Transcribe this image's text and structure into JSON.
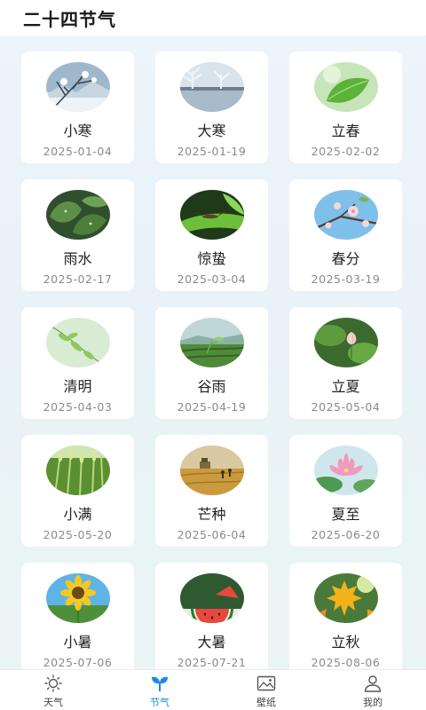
{
  "header": {
    "title": "二十四节气"
  },
  "terms": [
    {
      "name": "小寒",
      "date": "2025-01-04",
      "scene": "snow-tree"
    },
    {
      "name": "大寒",
      "date": "2025-01-19",
      "scene": "frost-lake"
    },
    {
      "name": "立春",
      "date": "2025-02-02",
      "scene": "green-leaf"
    },
    {
      "name": "雨水",
      "date": "2025-02-17",
      "scene": "rain-leaves"
    },
    {
      "name": "惊蛰",
      "date": "2025-03-04",
      "scene": "insect-leaf"
    },
    {
      "name": "春分",
      "date": "2025-03-19",
      "scene": "blossom-sky"
    },
    {
      "name": "清明",
      "date": "2025-04-03",
      "scene": "willow-leaves"
    },
    {
      "name": "谷雨",
      "date": "2025-04-19",
      "scene": "tea-field"
    },
    {
      "name": "立夏",
      "date": "2025-05-04",
      "scene": "lotus-bud"
    },
    {
      "name": "小满",
      "date": "2025-05-20",
      "scene": "wheat-green"
    },
    {
      "name": "芒种",
      "date": "2025-06-04",
      "scene": "harvest-field"
    },
    {
      "name": "夏至",
      "date": "2025-06-20",
      "scene": "lotus-flower"
    },
    {
      "name": "小暑",
      "date": "2025-07-06",
      "scene": "sunflower"
    },
    {
      "name": "大暑",
      "date": "2025-07-21",
      "scene": "watermelon"
    },
    {
      "name": "立秋",
      "date": "2025-08-06",
      "scene": "maple-leaf"
    }
  ],
  "tabbar": {
    "items": [
      {
        "label": "天气",
        "icon": "sun-icon",
        "active": false
      },
      {
        "label": "节气",
        "icon": "sprout-icon",
        "active": true
      },
      {
        "label": "壁纸",
        "icon": "image-icon",
        "active": false
      },
      {
        "label": "我的",
        "icon": "user-icon",
        "active": false
      }
    ]
  },
  "colors": {
    "accent": "#1e88e5",
    "background": "#eaf3f8",
    "card": "#ffffff"
  }
}
